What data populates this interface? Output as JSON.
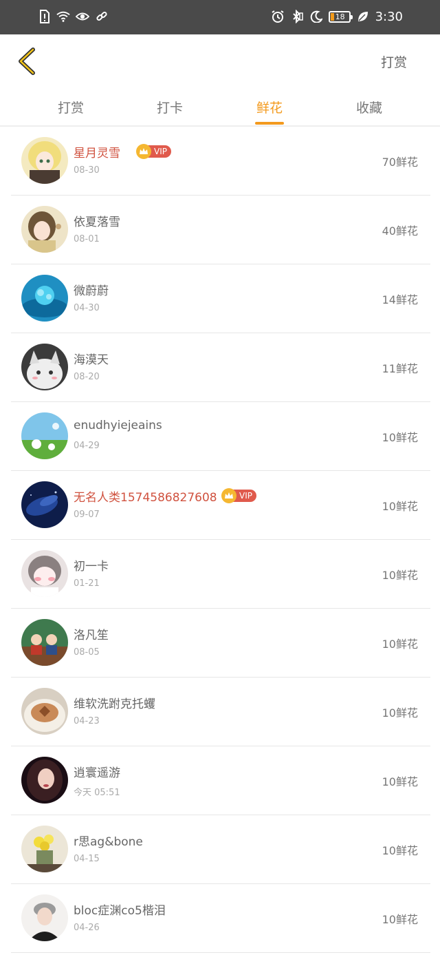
{
  "status_bar": {
    "time": "3:30",
    "battery": "18",
    "left_icons": [
      "alert-icon",
      "wifi-icon",
      "eye-icon",
      "link-icon"
    ],
    "right_icons": [
      "alarm-icon",
      "bluetooth-icon",
      "moon-icon",
      "battery-icon",
      "leaf-icon"
    ]
  },
  "header": {
    "back_icon": "chevron-left-icon",
    "action_label": "打赏"
  },
  "tabs": [
    {
      "label": "打赏",
      "active": false
    },
    {
      "label": "打卡",
      "active": false
    },
    {
      "label": "鲜花",
      "active": true
    },
    {
      "label": "收藏",
      "active": false
    }
  ],
  "colors": {
    "accent": "#f39a1e",
    "vip_name": "#d0523f",
    "vip_tag": "#e05a4c",
    "crown": "#f5b731"
  },
  "vip_label": "VIP",
  "rows": [
    {
      "name": "星月灵雪",
      "date": "08-30",
      "count": "70鲜花",
      "vip": true
    },
    {
      "name": "依夏落雪",
      "date": "08-01",
      "count": "40鲜花",
      "vip": false
    },
    {
      "name": "微蔚蔚",
      "date": "04-30",
      "count": "14鲜花",
      "vip": false
    },
    {
      "name": "海漠天",
      "date": "08-20",
      "count": "11鲜花",
      "vip": false
    },
    {
      "name": "enudhyiejeains",
      "date": "04-29",
      "count": "10鲜花",
      "vip": false
    },
    {
      "name": "无名人类1574586827608",
      "date": "09-07",
      "count": "10鲜花",
      "vip": true
    },
    {
      "name": "初一卡",
      "date": "01-21",
      "count": "10鲜花",
      "vip": false
    },
    {
      "name": "洛凡笙",
      "date": "08-05",
      "count": "10鲜花",
      "vip": false
    },
    {
      "name": "维软洗跗克托蠼",
      "date": "04-23",
      "count": "10鲜花",
      "vip": false
    },
    {
      "name": "逍寰遥游",
      "date": "今天 05:51",
      "count": "10鲜花",
      "vip": false
    },
    {
      "name": "r思ag&bone",
      "date": "04-15",
      "count": "10鲜花",
      "vip": false
    },
    {
      "name": "bloc症渊co5楷泪",
      "date": "04-26",
      "count": "10鲜花",
      "vip": false
    }
  ]
}
